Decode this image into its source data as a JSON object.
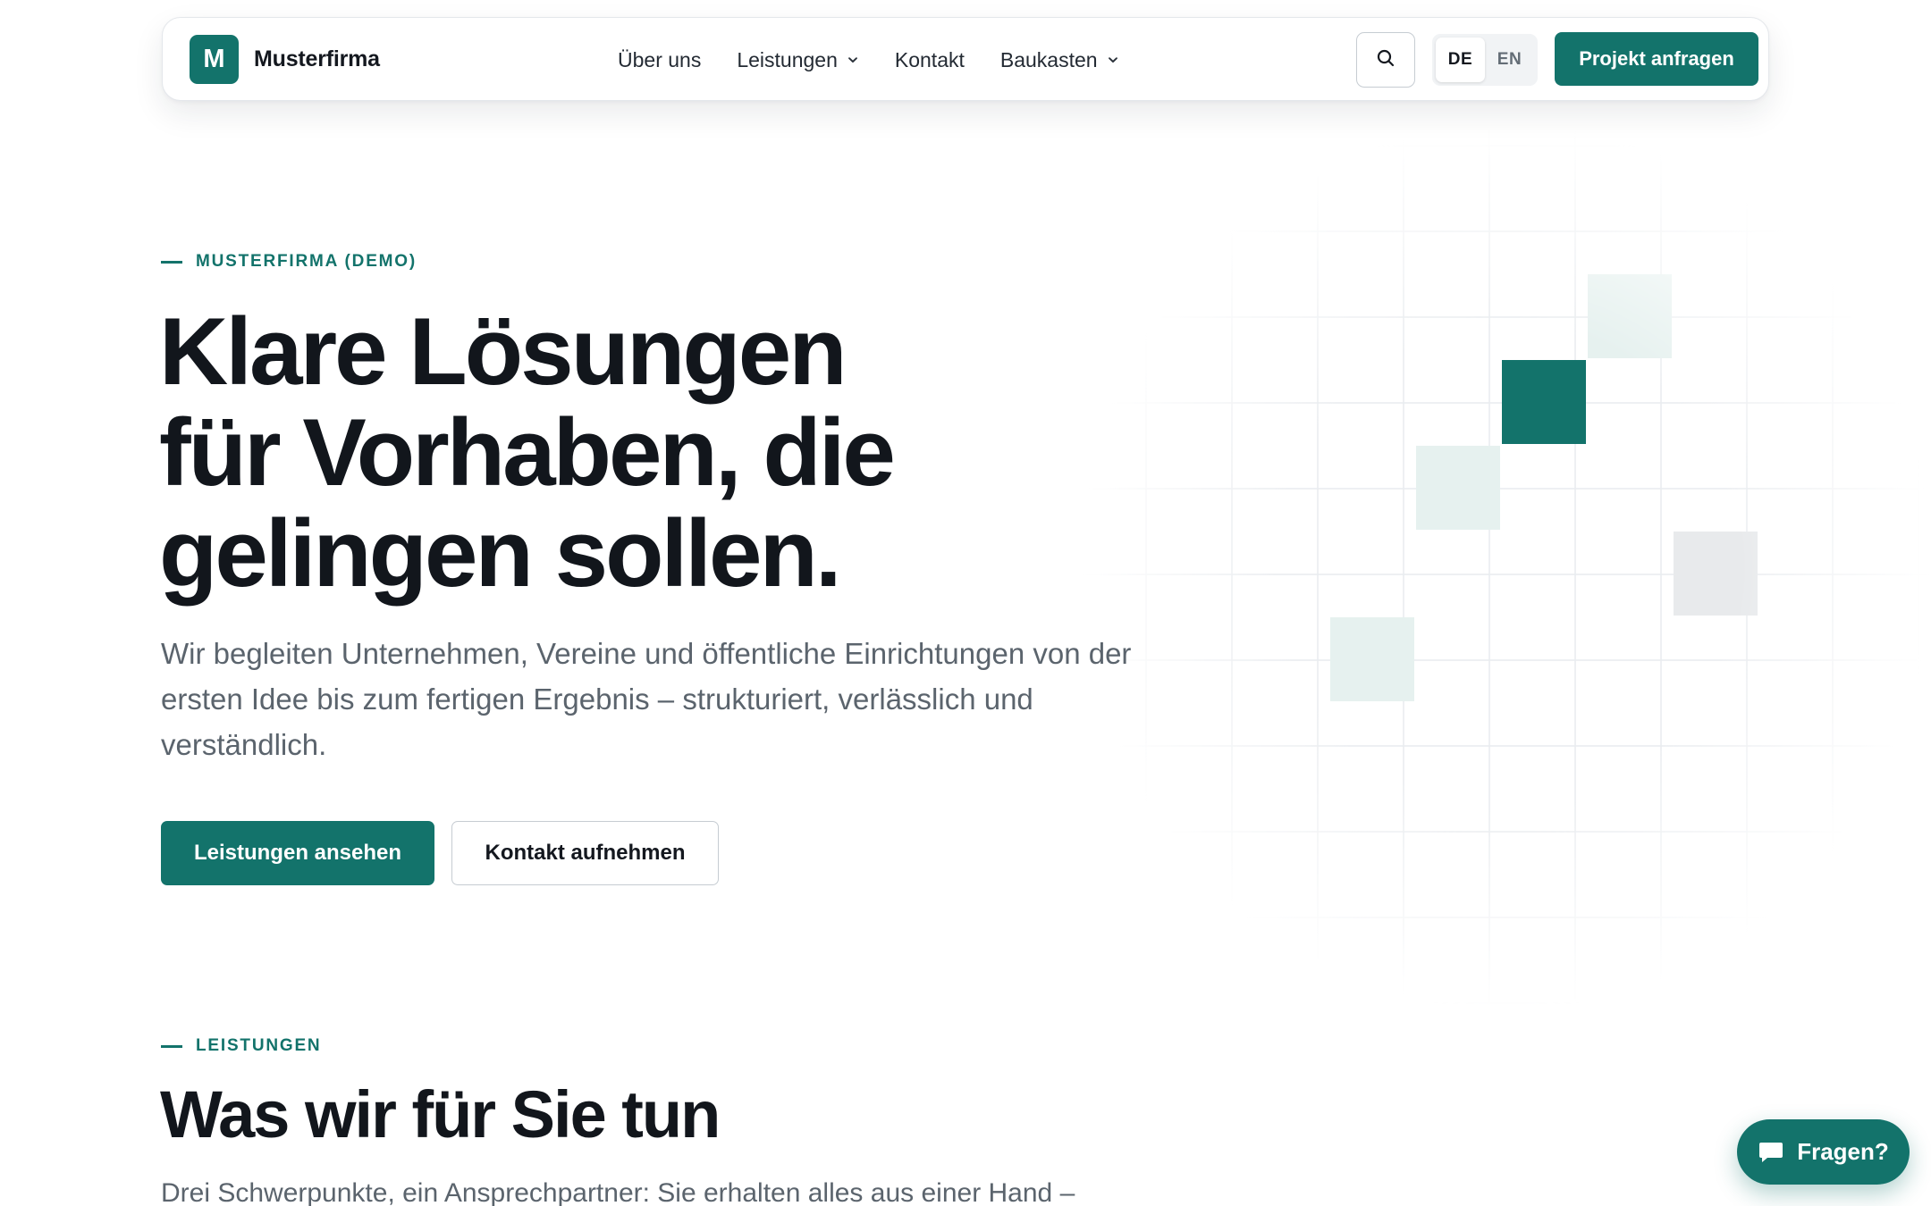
{
  "header": {
    "logo_letter": "M",
    "brand": "Musterfirma",
    "nav": [
      {
        "label": "Über uns",
        "dropdown": false
      },
      {
        "label": "Leistungen",
        "dropdown": true
      },
      {
        "label": "Kontakt",
        "dropdown": false
      },
      {
        "label": "Baukasten",
        "dropdown": true
      }
    ],
    "search_icon": "search-icon",
    "languages": [
      {
        "code": "DE",
        "active": true
      },
      {
        "code": "EN",
        "active": false
      }
    ],
    "cta_label": "Projekt anfragen"
  },
  "hero": {
    "eyebrow": "MUSTERFIRMA (DEMO)",
    "title_lines": [
      "Klare Lösungen",
      "für Vorhaben, die",
      "gelingen sollen."
    ],
    "lede": "Wir begleiten Unternehmen, Vereine und öffentliche Einrichtungen von der ersten Idee bis zum fertigen Ergebnis – strukturiert, verlässlich und verständlich.",
    "primary_button": "Leistungen ansehen",
    "secondary_button": "Kontakt aufnehmen"
  },
  "services": {
    "eyebrow": "LEISTUNGEN",
    "title": "Was wir für Sie tun",
    "lede": "Drei Schwerpunkte, ein Ansprechpartner: Sie erhalten alles aus einer Hand –"
  },
  "chat": {
    "label": "Fragen?",
    "icon": "chat-bubble-icon"
  },
  "colors": {
    "accent": "#13736b",
    "accent_tint": "#e6f1ef",
    "neutral_tint": "#e8eaec",
    "text": "#14181f",
    "muted_text": "#5b646d",
    "border": "#c6ccd2"
  }
}
